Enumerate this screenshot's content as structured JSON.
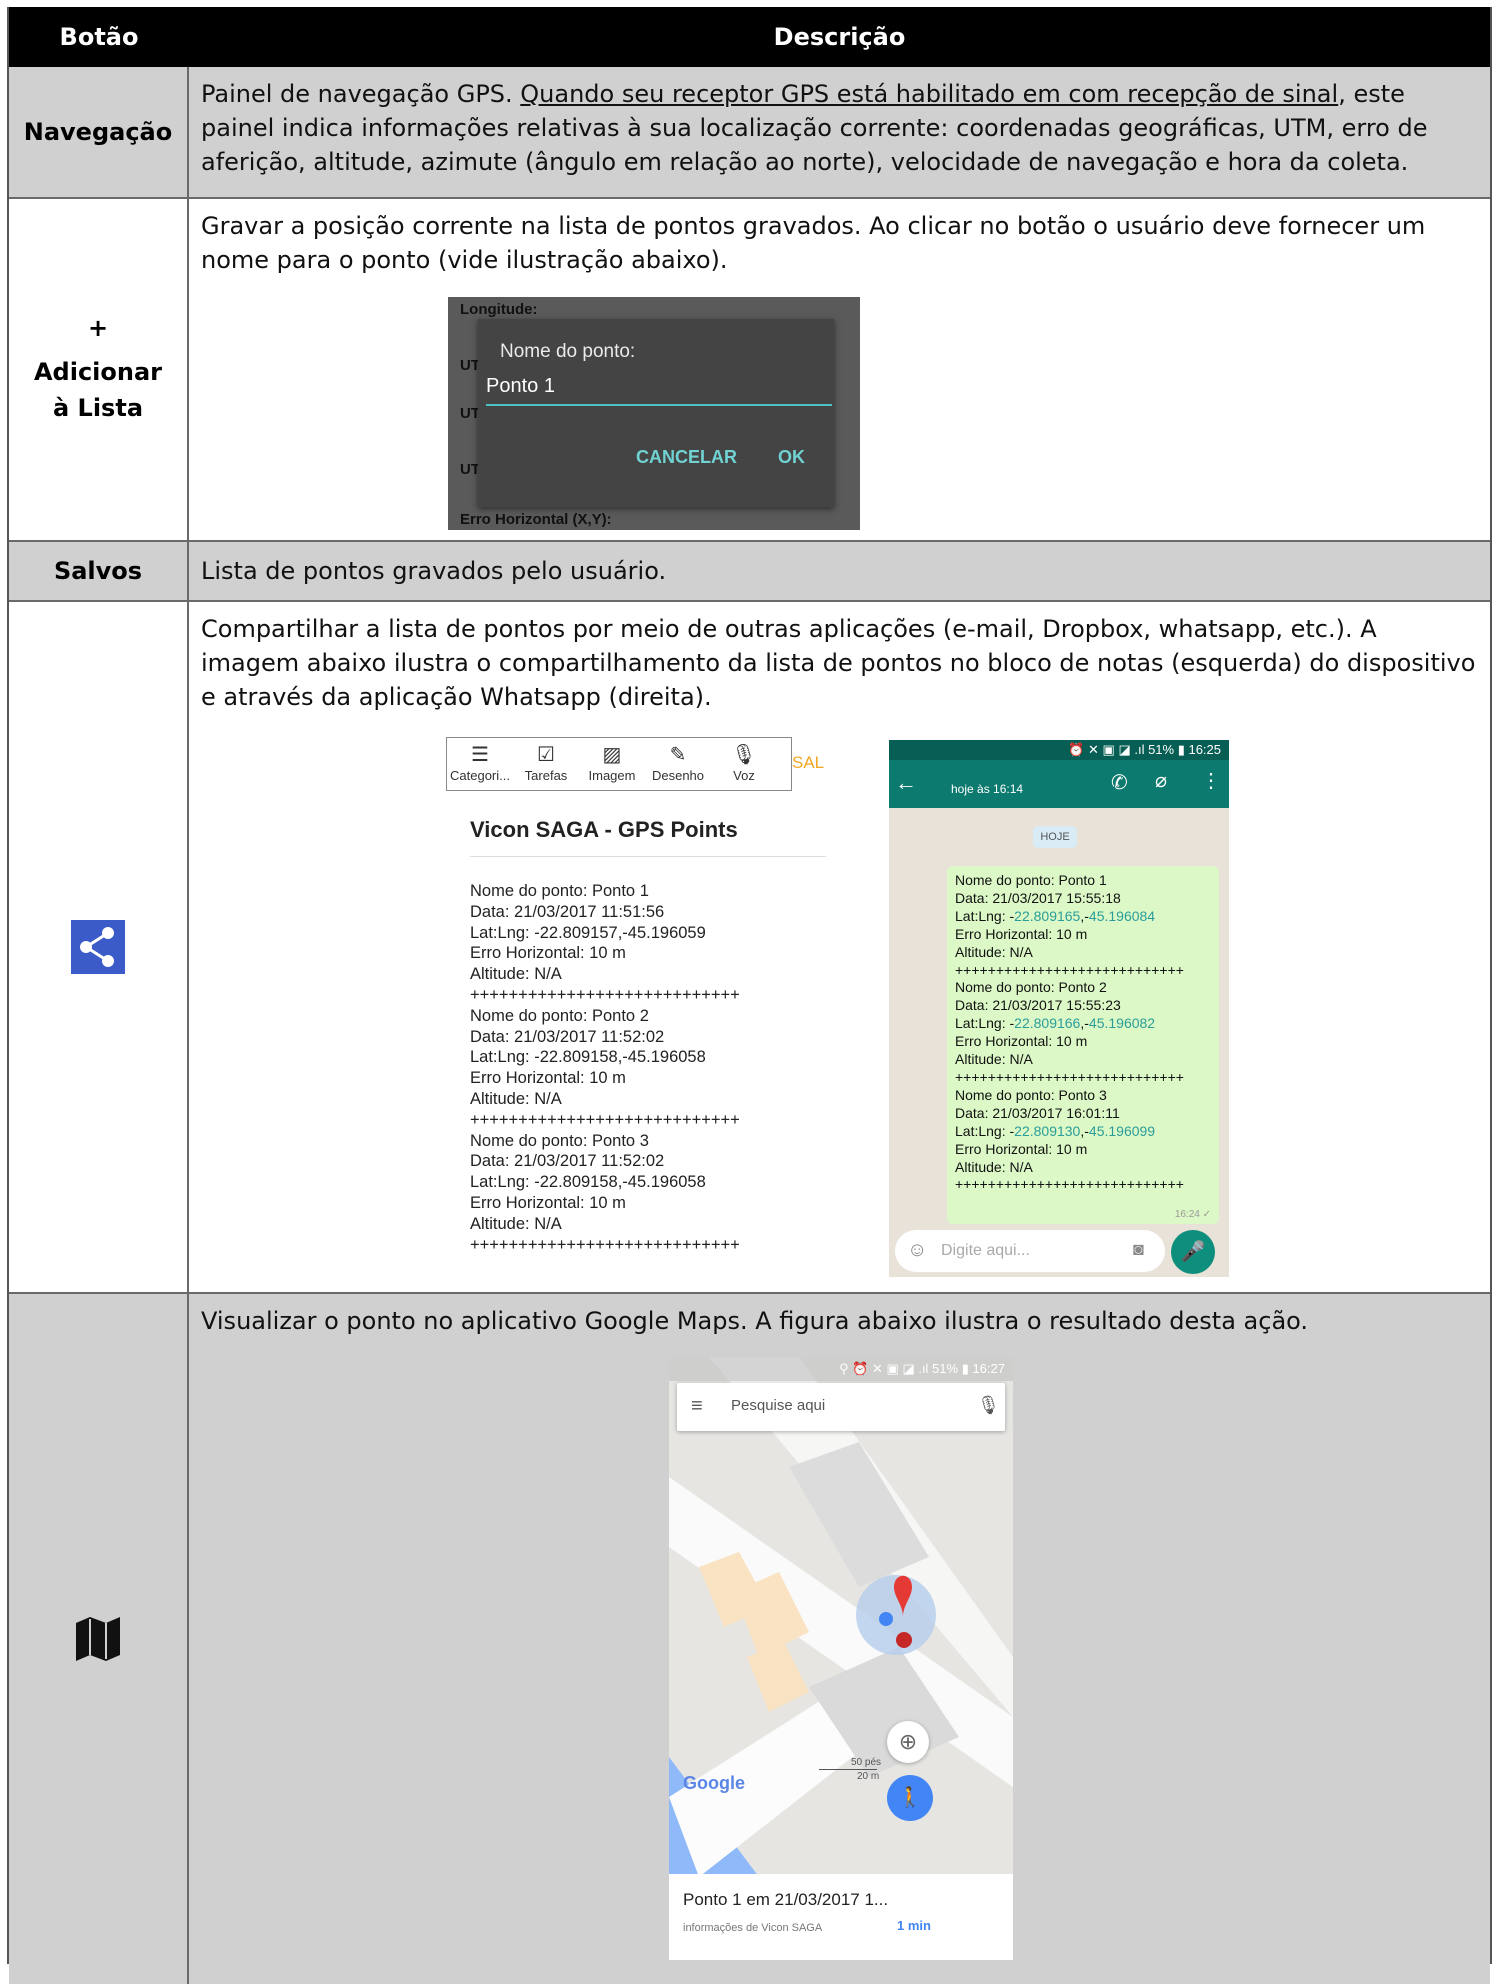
{
  "header": {
    "col1": "Botão",
    "col2": "Descrição"
  },
  "rows": {
    "navegacao": {
      "label": "Navegação",
      "text_pre": "Painel de navegação GPS.  ",
      "text_underlined": "Quando seu receptor GPS está habilitado em com recepção de sinal",
      "text_post": ", este painel indica informações relativas à sua localização corrente: coordenadas geográficas, UTM, erro de aferição, altitude, azimute (ângulo em relação ao norte), velocidade de navegação e hora da coleta."
    },
    "adicionar": {
      "label_plus": "+",
      "label": "Adicionar à Lista",
      "text": "Gravar a posição corrente na lista de pontos gravados.  Ao clicar no botão o usuário deve fornecer um nome para o ponto (vide ilustração abaixo).",
      "dialog": {
        "bg_top": "Longitude:",
        "bg_utm": "UT",
        "bg_bottom": "Erro Horizontal (X,Y):",
        "title": "Nome do ponto:",
        "value": "Ponto 1",
        "cancel": "CANCELAR",
        "ok": "OK"
      }
    },
    "salvos": {
      "label": "Salvos",
      "text": "Lista de pontos gravados pelo usuário."
    },
    "share": {
      "icon": "share-icon",
      "text": "Compartilhar a lista de pontos por meio de outras aplicações (e-mail, Dropbox, whatsapp, etc.).  A imagem abaixo ilustra o compartilhamento da lista de pontos no bloco de notas (esquerda) do dispositivo e através da aplicação Whatsapp (direita).",
      "notes": {
        "toolbar": [
          "Categori...",
          "Tarefas",
          "Imagem",
          "Desenho",
          "Voz"
        ],
        "save": "SAL",
        "title": "Vicon SAGA - GPS Points",
        "body": "Nome do ponto: Ponto 1\nData: 21/03/2017 11:51:56\nLat:Lng: -22.809157,-45.196059\nErro Horizontal: 10 m\nAltitude: N/A\n++++++++++++++++++++++++++++\nNome do ponto: Ponto 2\nData: 21/03/2017 11:52:02\nLat:Lng: -22.809158,-45.196058\nErro Horizontal: 10 m\nAltitude: N/A\n++++++++++++++++++++++++++++\nNome do ponto: Ponto 3\nData: 21/03/2017 11:52:02\nLat:Lng: -22.809158,-45.196058\nErro Horizontal: 10 m\nAltitude: N/A\n++++++++++++++++++++++++++++"
      },
      "whatsapp": {
        "status": "⏰ ✕ ▣ ◪ .ıl 51% ▮ 16:25",
        "subtitle": "hoje às 16:14",
        "day_chip": "HOJE",
        "points": [
          {
            "name": "Nome do ponto: Ponto 1",
            "date": "Data: 21/03/2017 15:55:18",
            "lat": "22.809165",
            "lng": "45.196084"
          },
          {
            "name": "Nome do ponto: Ponto 2",
            "date": "Data: 21/03/2017 15:55:23",
            "lat": "22.809166",
            "lng": "45.196082"
          },
          {
            "name": "Nome do ponto: Ponto 3",
            "date": "Data: 21/03/2017 16:01:11",
            "lat": "22.809130",
            "lng": "45.196099"
          }
        ],
        "erro": "Erro Horizontal: 10 m",
        "altitude": "Altitude: N/A",
        "sep": "++++++++++++++++++++++++++++",
        "time": "16:24 ✓",
        "input_placeholder": "Digite aqui..."
      }
    },
    "maps": {
      "icon": "map-icon",
      "text": "Visualizar o ponto no aplicativo Google Maps.  A figura abaixo ilustra o resultado desta ação.",
      "status": "⚲ ⏰ ✕ ▣ ◪ .ıl 51% ▮ 16:27",
      "search_placeholder": "Pesquise aqui",
      "scale_ft": "50 pés",
      "scale_m": "20 m",
      "google": "Google",
      "card_title": "Ponto 1 em 21/03/2017 1...",
      "card_sub": "informações de Vicon SAGA",
      "card_time": "1 min"
    }
  }
}
